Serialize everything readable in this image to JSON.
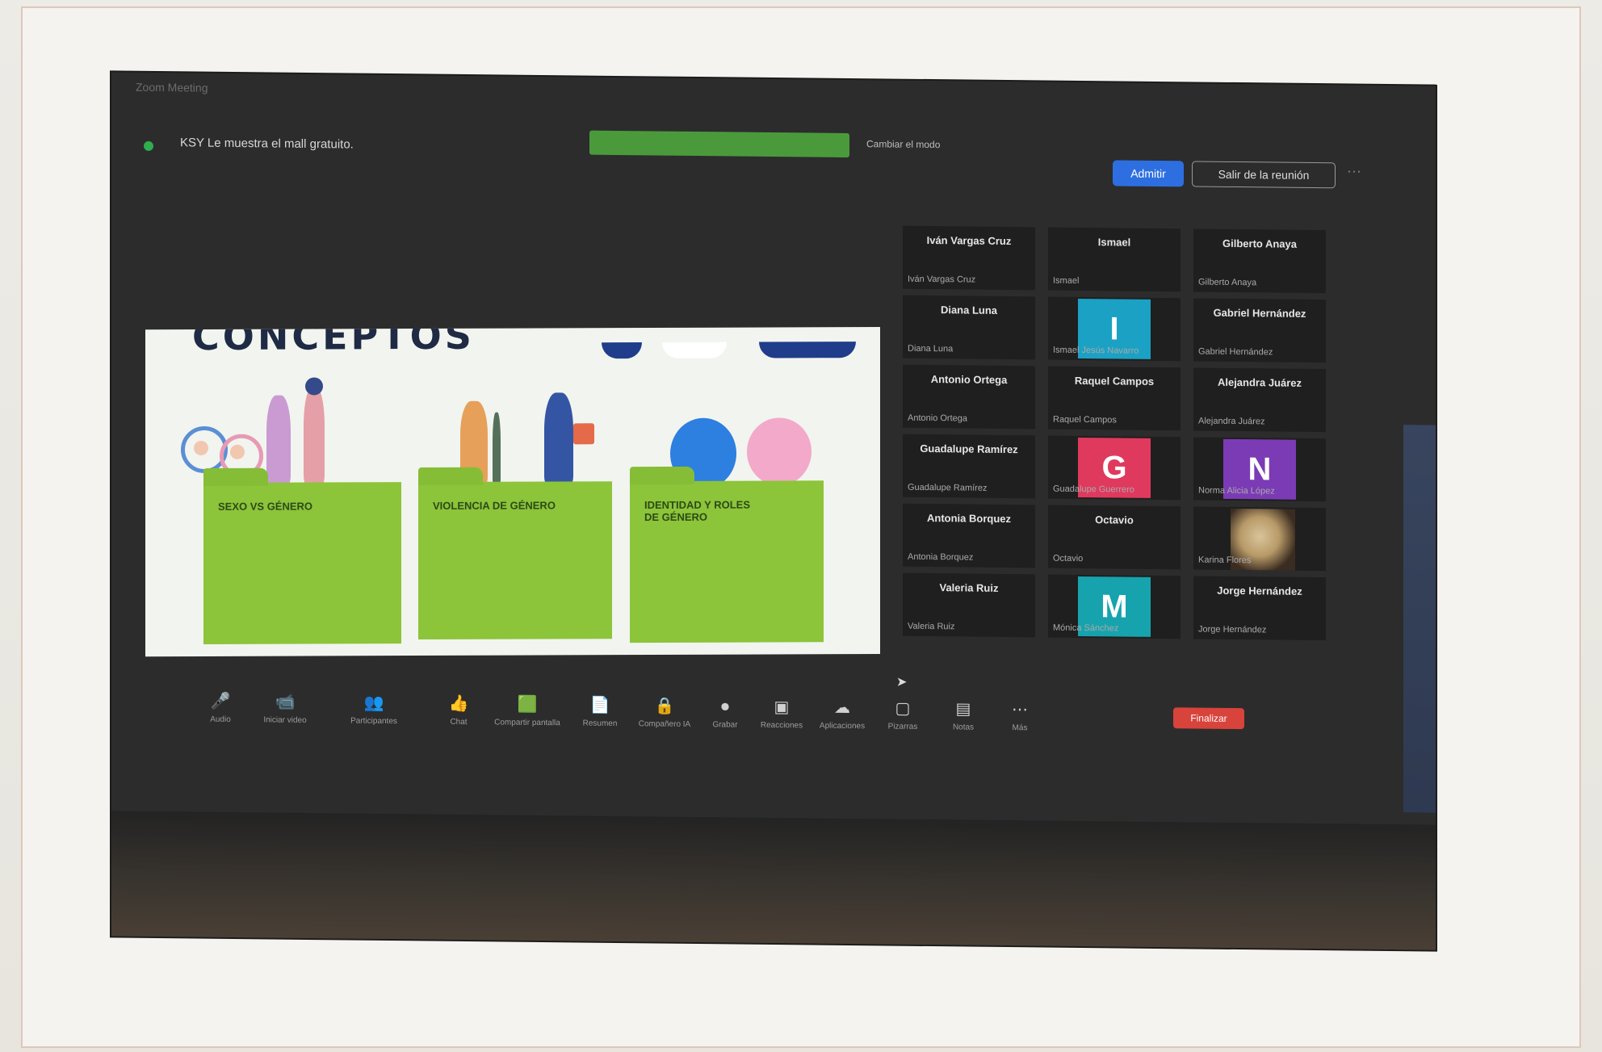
{
  "app_label": "Zoom Meeting",
  "topbar": {
    "meeting_info": "KSY Le muestra el mall gratuito.",
    "banner_link": "Cambiar el modo",
    "admit_label": "Admitir",
    "leave_label": "Salir de la reunión",
    "more_label": "···"
  },
  "slide": {
    "title": "CONCEPTOS",
    "cards": [
      {
        "label": "SEXO VS GÉNERO"
      },
      {
        "label": "VIOLENCIA DE GÉNERO"
      },
      {
        "label": "IDENTIDAD Y ROLES DE GÉNERO"
      }
    ],
    "colors": {
      "folder": "#8cc43a",
      "background": "#f2f4ef",
      "title": "#1f2a44",
      "accent_blue": "#2d7fe0",
      "accent_pink": "#f3a9c9"
    }
  },
  "participants": [
    {
      "name": "Iván Vargas Cruz",
      "footer": "Iván Vargas Cruz",
      "type": "name"
    },
    {
      "name": "Ismael",
      "footer": "Ismael",
      "type": "name"
    },
    {
      "name": "Gilberto Anaya",
      "footer": "Gilberto Anaya",
      "type": "name"
    },
    {
      "name": "Diana Luna",
      "footer": "Diana Luna",
      "type": "name"
    },
    {
      "name": "I",
      "footer": "Ismael Jesús Navarro",
      "type": "avatar",
      "color": "#1aa1c4"
    },
    {
      "name": "Gabriel Hernández",
      "footer": "Gabriel Hernández",
      "type": "name"
    },
    {
      "name": "Antonio Ortega",
      "footer": "Antonio Ortega",
      "type": "name"
    },
    {
      "name": "Raquel Campos",
      "footer": "Raquel Campos",
      "type": "name"
    },
    {
      "name": "Alejandra Juárez",
      "footer": "Alejandra Juárez",
      "type": "name"
    },
    {
      "name": "Guadalupe Ramírez",
      "footer": "Guadalupe Ramírez",
      "type": "name"
    },
    {
      "name": "G",
      "footer": "Guadalupe Guerrero",
      "type": "avatar",
      "color": "#e0395e"
    },
    {
      "name": "N",
      "footer": "Norma Alicia López",
      "type": "avatar",
      "color": "#7b3bb5"
    },
    {
      "name": "Antonia Borquez",
      "footer": "Antonia Borquez",
      "type": "name"
    },
    {
      "name": "Octavio",
      "footer": "Octavio",
      "type": "name"
    },
    {
      "name": "",
      "footer": "Karina Flores",
      "type": "photo"
    },
    {
      "name": "Valeria Ruiz",
      "footer": "Valeria Ruiz",
      "type": "name"
    },
    {
      "name": "M",
      "footer": "Mónica Sánchez",
      "type": "avatar",
      "color": "#17a3ad"
    },
    {
      "name": "Jorge Hernández",
      "footer": "Jorge Hernández",
      "type": "name"
    }
  ],
  "toolbar": {
    "items": [
      {
        "icon": "🎤",
        "label": "Audio"
      },
      {
        "icon": "📹",
        "label": "Iniciar video"
      },
      {
        "icon": "👥",
        "label": "Participantes"
      },
      {
        "icon": "👍",
        "label": "Chat"
      },
      {
        "icon": "🟩",
        "label": "Compartir pantalla"
      },
      {
        "icon": "📄",
        "label": "Resumen"
      },
      {
        "icon": "🔒",
        "label": "Compañero IA"
      },
      {
        "icon": "⏺",
        "label": "Grabar"
      },
      {
        "icon": "▣",
        "label": "Reacciones"
      },
      {
        "icon": "☁",
        "label": "Aplicaciones"
      },
      {
        "icon": "▢",
        "label": "Pizarras"
      },
      {
        "icon": "▤",
        "label": "Notas"
      },
      {
        "icon": "⋯",
        "label": "Más"
      }
    ],
    "end_label": "Finalizar"
  }
}
